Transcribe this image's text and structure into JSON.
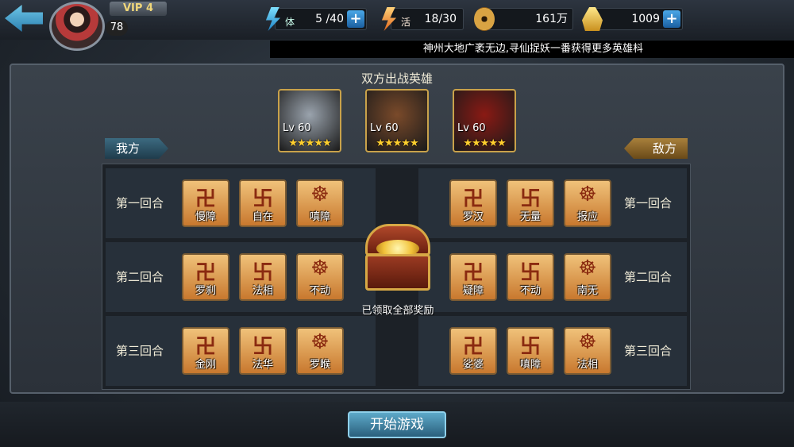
{
  "topbar": {
    "vip": "VIP 4",
    "player_level": "78",
    "stamina": {
      "icon": "stamina-bolt-icon",
      "badge": "体",
      "value": "5 /40"
    },
    "energy": {
      "icon": "energy-bolt-icon",
      "badge": "活",
      "value": "18/30"
    },
    "coins": {
      "icon": "copper-coin-icon",
      "value": "161万"
    },
    "gold": {
      "icon": "gold-ingot-icon",
      "value": "1009"
    },
    "plus": "+"
  },
  "ticker": "神州大地广袤无边,寻仙捉妖一番获得更多英雄枓",
  "main": {
    "title": "双方出战英雄",
    "heroes": [
      {
        "level": "Lv 60",
        "stars": "★★★★★",
        "color": "#9aa3ad"
      },
      {
        "level": "Lv 60",
        "stars": "★★★★★",
        "color": "#7a4a2a"
      },
      {
        "level": "Lv 60",
        "stars": "★★★★★",
        "color": "#8a1a14"
      }
    ],
    "our_side": "我方",
    "enemy_side": "敌方",
    "rounds": [
      {
        "label": "第一回合",
        "ours": [
          "慢障",
          "自在",
          "嗔障"
        ],
        "enemy": [
          "罗汉",
          "无量",
          "报应"
        ]
      },
      {
        "label": "第二回合",
        "ours": [
          "罗刹",
          "法相",
          "不动"
        ],
        "enemy": [
          "疑障",
          "不动",
          "南无"
        ]
      },
      {
        "label": "第三回合",
        "ours": [
          "金刚",
          "法华",
          "罗睺"
        ],
        "enemy": [
          "娑婆",
          "嗔障",
          "法相"
        ]
      }
    ],
    "chest_caption": "已领取全部奖励",
    "start_button": "开始游戏"
  }
}
